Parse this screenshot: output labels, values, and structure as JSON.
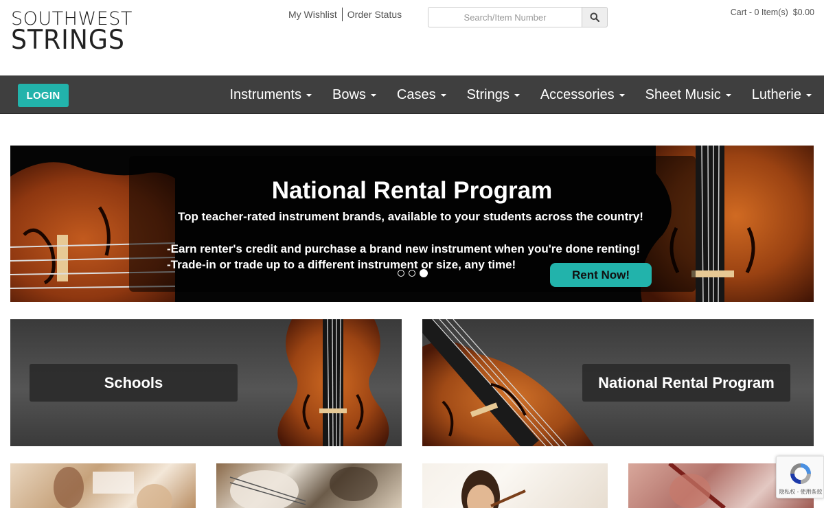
{
  "header": {
    "logo_line1": "SOUTHWEST",
    "logo_line2": "STRINGS",
    "links": {
      "wishlist": "My Wishlist",
      "order_status": "Order Status"
    },
    "search": {
      "placeholder": "Search/Item Number",
      "icon": "search-icon"
    },
    "cart": "Cart - 0 Item(s)  $0.00"
  },
  "nav": {
    "login": "LOGIN",
    "items": [
      "Instruments",
      "Bows",
      "Cases",
      "Strings",
      "Accessories",
      "Sheet Music",
      "Lutherie"
    ],
    "accent_color": "#22b3ab",
    "bar_color": "#3f3f3f"
  },
  "hero": {
    "title": "National Rental Program",
    "subtitle": "Top teacher-rated instrument brands, available to your students across the country!",
    "bullet1": "-Earn renter's credit and purchase a brand new instrument when you're done renting!",
    "bullet2": "-Trade-in or trade up to a different instrument or size, any time!",
    "cta": "Rent Now!",
    "slide_count": 3,
    "active_slide": 3
  },
  "tiles": {
    "schools": "Schools",
    "rental": "National Rental Program"
  },
  "recaptcha": {
    "text": "隐私权 - 使用条款"
  }
}
